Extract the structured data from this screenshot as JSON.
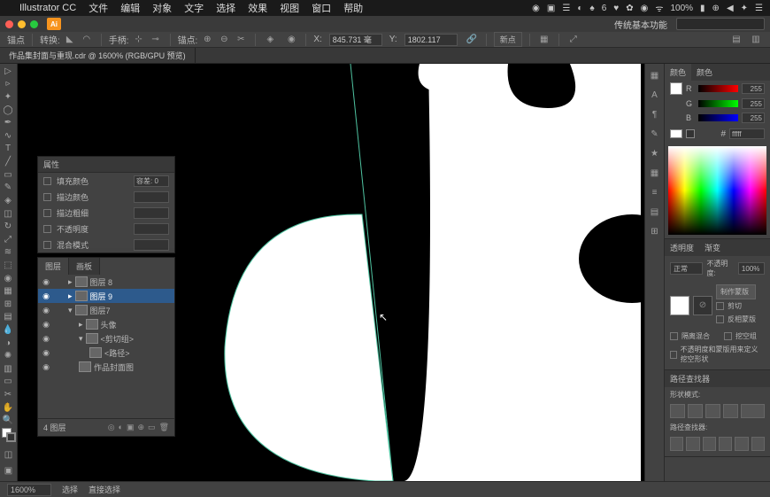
{
  "menubar": {
    "app": "Illustrator CC",
    "items": [
      "文件",
      "编辑",
      "对象",
      "文字",
      "选择",
      "效果",
      "视图",
      "窗口",
      "帮助"
    ],
    "battery": "100%",
    "wifi_icon": "▲"
  },
  "window": {
    "ai_badge": "Ai",
    "essentials": "传统基本功能"
  },
  "controlbar": {
    "tool_label": "锚点",
    "convert_label": "转换:",
    "handle_label": "手柄:",
    "anchor_label": "锚点:",
    "x_label": "X:",
    "y_label": "Y:",
    "x_val": "845.731 毫",
    "y_val": "1802.117",
    "go_label": "新点"
  },
  "tab": {
    "doc_name": "作品集封面与重现.cdr @ 1600% (RGB/GPU 预览)"
  },
  "appearance_panel": {
    "title": "属性",
    "fill_label": "填充颜色",
    "stroke_label": "描边颜色",
    "stroke_align_label": "描边粗细",
    "opacity_label": "不透明度",
    "blend_label": "混合模式",
    "opacity_field": "容差: 0"
  },
  "layers": {
    "tab1": "图层",
    "tab2": "画板",
    "count_label": "4 图层",
    "items": [
      {
        "indent": 0,
        "name": "图层 8"
      },
      {
        "indent": 0,
        "name": "图层 9",
        "selected": true
      },
      {
        "indent": 0,
        "name": "图层7"
      },
      {
        "indent": 1,
        "name": "头像"
      },
      {
        "indent": 1,
        "name": "<剪切组>"
      },
      {
        "indent": 2,
        "name": "<路径>"
      },
      {
        "indent": 1,
        "name": "作品封面图"
      }
    ]
  },
  "color_panel": {
    "tab1": "颜色",
    "tab2": "颜色",
    "r": "255",
    "g": "255",
    "b": "255",
    "hex_prefix": "#",
    "hex": "fffff"
  },
  "transparency": {
    "tab1": "透明度",
    "tab2": "渐变",
    "mode": "正常",
    "opacity_label": "不透明度:",
    "opacity_val": "100%",
    "make_mask": "制作蒙版",
    "clip": "剪切",
    "invert": "反相蒙版",
    "iso": "隔离混合",
    "ko": "挖空组",
    "desc": "不透明度和蒙版用来定义挖空形状"
  },
  "pathfinder": {
    "title": "路径查找器",
    "shape_modes": "形状模式:",
    "pathfinders": "路径查找器:"
  },
  "status": {
    "zoom": "1600%",
    "nav1": "选择",
    "nav2": "直接选择"
  }
}
